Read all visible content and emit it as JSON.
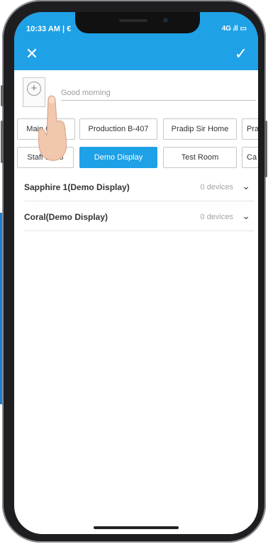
{
  "status": {
    "time": "10:33 AM | €",
    "indicators": "4G ᵢll ▭"
  },
  "header": {
    "close_icon": "✕",
    "check_icon": "✓"
  },
  "greeting_placeholder": "Good morning",
  "add_button": {
    "symbol": "+"
  },
  "chips_row1": [
    "Main Office",
    "Production B-407",
    "Pradip Sir Home",
    "Pra"
  ],
  "chips_row2": [
    "Staff B408",
    "Demo Display",
    "Test Room",
    "Ca"
  ],
  "active_chip": "Demo Display",
  "groups": [
    {
      "name": "Sapphire 1(Demo Display)",
      "count": "0 devices"
    },
    {
      "name": "Coral(Demo Display)",
      "count": "0 devices"
    }
  ],
  "colors": {
    "accent": "#1ea1e6"
  }
}
